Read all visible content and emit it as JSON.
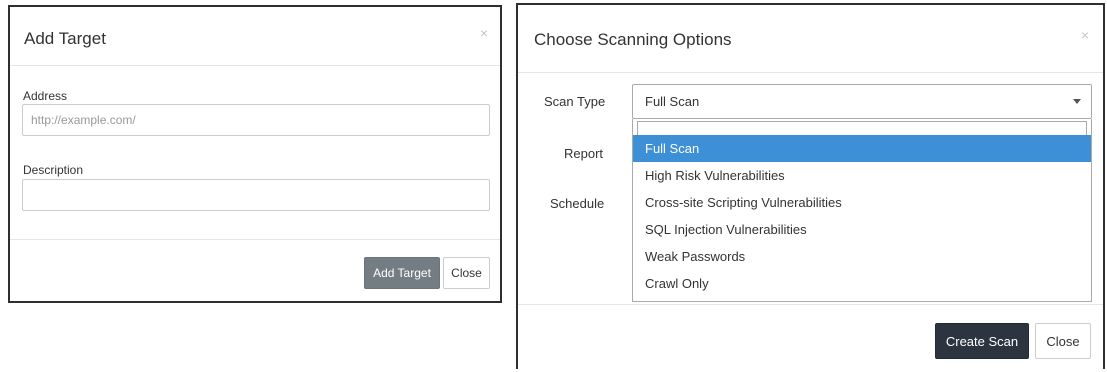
{
  "add_target_modal": {
    "title": "Add Target",
    "close_symbol": "×",
    "address_label": "Address",
    "address_placeholder": "http://example.com/",
    "address_value": "",
    "description_label": "Description",
    "description_value": "",
    "add_button": "Add Target",
    "close_button": "Close"
  },
  "scan_options_modal": {
    "title": "Choose Scanning Options",
    "close_symbol": "×",
    "scan_type_label": "Scan Type",
    "scan_type_selected": "Full Scan",
    "report_label": "Report",
    "schedule_label": "Schedule",
    "options": [
      "Full Scan",
      "High Risk Vulnerabilities",
      "Cross-site Scripting Vulnerabilities",
      "SQL Injection Vulnerabilities",
      "Weak Passwords",
      "Crawl Only"
    ],
    "create_button": "Create Scan",
    "close_button": "Close"
  },
  "colors": {
    "highlight": "#3d8fd6",
    "primary_dark": "#2c3440",
    "secondary_gray": "#747c84"
  }
}
